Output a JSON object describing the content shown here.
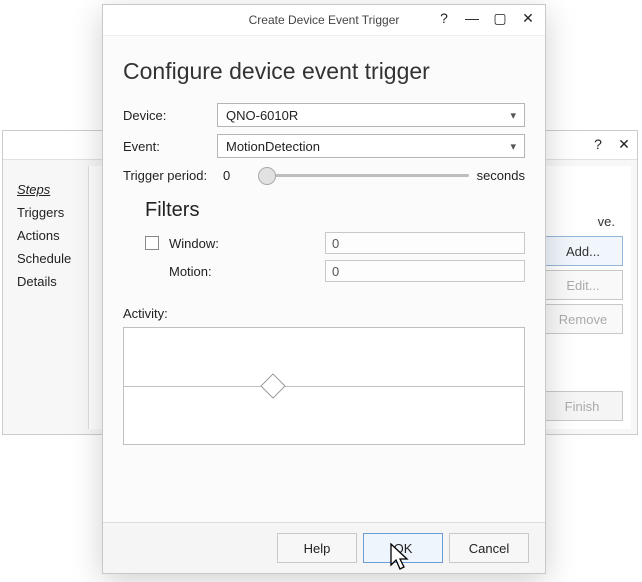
{
  "back_window": {
    "help_icon": "?",
    "close_icon": "✕",
    "steps_header": "Steps",
    "steps": [
      "Triggers",
      "Actions",
      "Schedule",
      "Details"
    ],
    "move_hint_tail": "ve.",
    "buttons": {
      "add": "Add...",
      "edit": "Edit...",
      "remove": "Remove",
      "finish": "Finish"
    }
  },
  "dialog": {
    "title": "Create Device Event Trigger",
    "help_icon": "?",
    "minimize_icon": "—",
    "maximize_icon": "▢",
    "close_icon": "✕",
    "heading": "Configure device event trigger",
    "device_label": "Device:",
    "device_value": "QNO-6010R",
    "event_label": "Event:",
    "event_value": "MotionDetection",
    "trigger_label": "Trigger period:",
    "trigger_value": "0",
    "trigger_suffix": "seconds",
    "filters_title": "Filters",
    "window_label": "Window:",
    "window_value": "0",
    "motion_label": "Motion:",
    "motion_value": "0",
    "activity_label": "Activity:",
    "buttons": {
      "help": "Help",
      "ok": "OK",
      "cancel": "Cancel"
    }
  }
}
